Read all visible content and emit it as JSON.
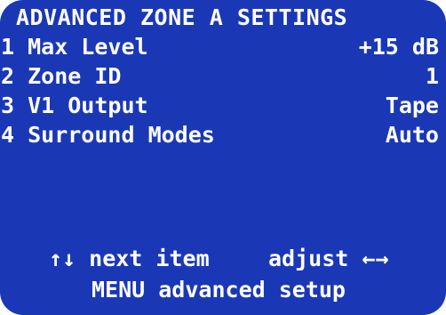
{
  "screen": {
    "title": "ADVANCED ZONE A SETTINGS",
    "background_color": "#1a38b6",
    "text_color": "#ffffff"
  },
  "menu_items": [
    {
      "label": "1 Max Level",
      "value": "+15 dB"
    },
    {
      "label": "2 Zone ID",
      "value": "1"
    },
    {
      "label": "3 V1 Output",
      "value": "Tape"
    },
    {
      "label": "4 Surround Modes",
      "value": "Auto"
    }
  ],
  "footer": {
    "next_item_hint": "↑↓ next item",
    "adjust_hint": "adjust ←→",
    "menu_hint": "MENU advanced setup"
  }
}
